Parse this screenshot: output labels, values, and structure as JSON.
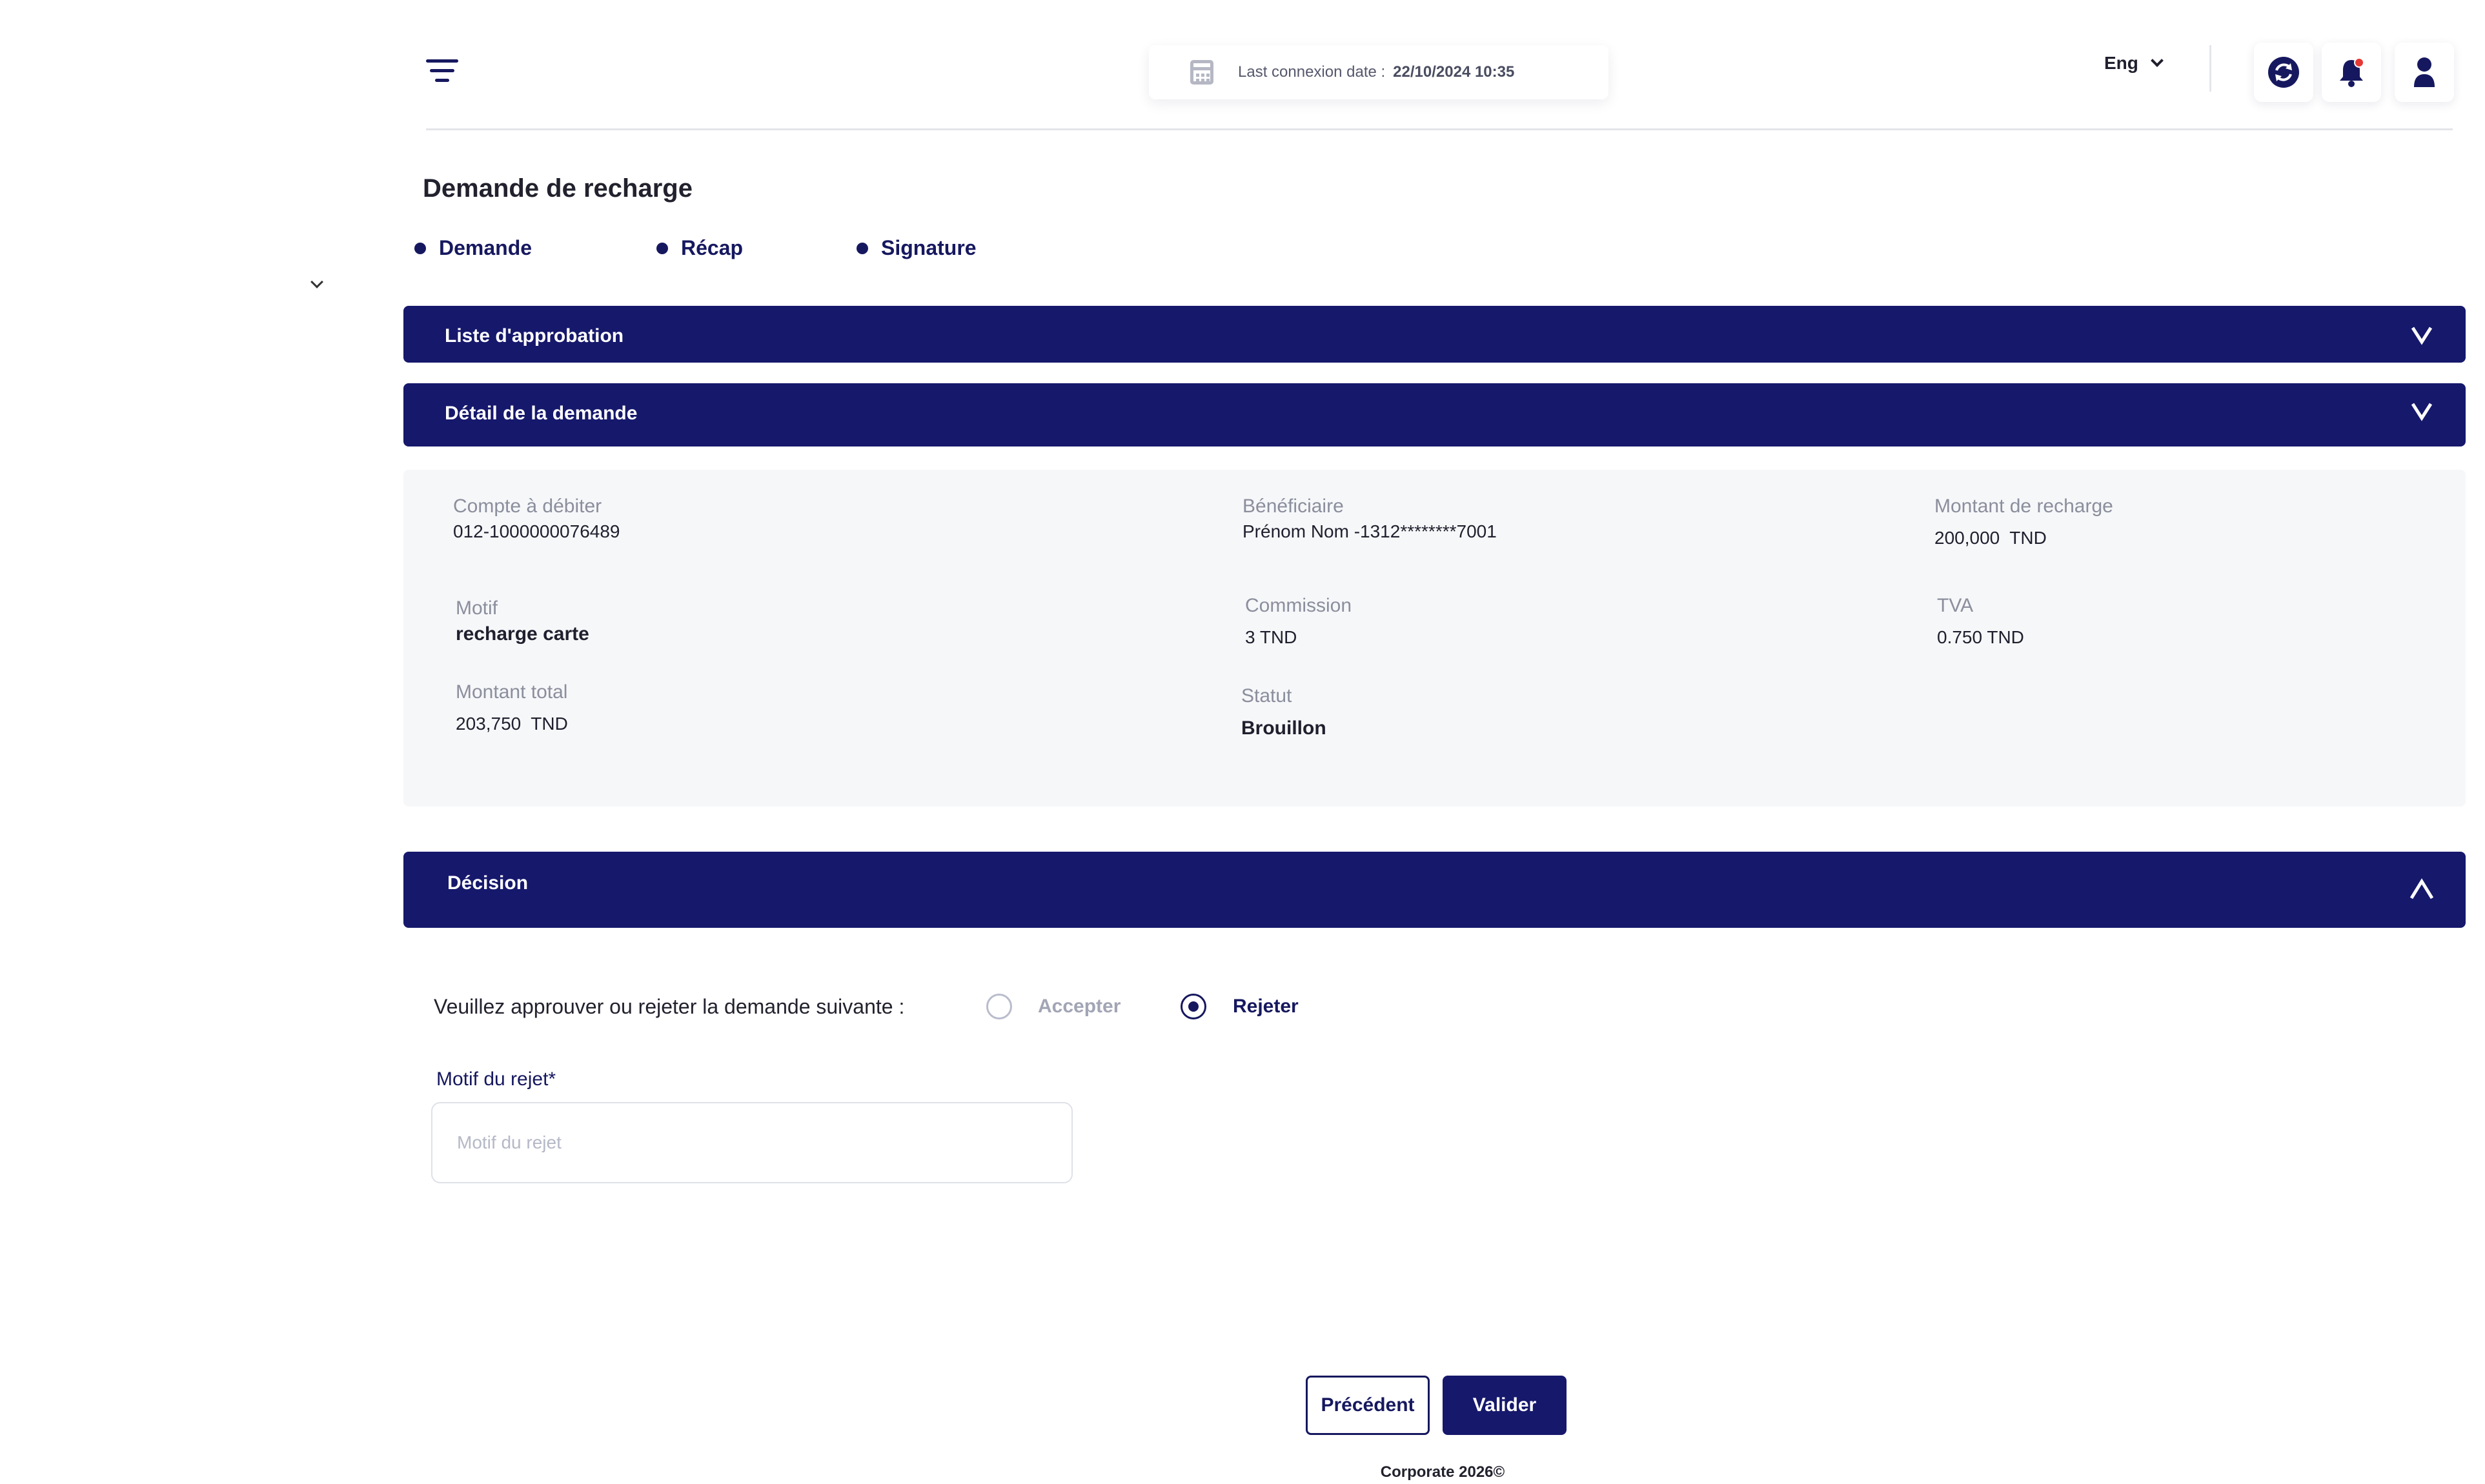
{
  "header": {
    "last_connexion_label": "Last connexion date :",
    "last_connexion_value": "22/10/2024 10:35",
    "language": "Eng",
    "icons": [
      "menu-icon",
      "calendar-icon",
      "sync-icon",
      "bell-icon",
      "user-icon"
    ],
    "notification_dot_color": "#e53935"
  },
  "page": {
    "title": "Demande de recharge",
    "steps": [
      "Demande",
      "Récap",
      "Signature"
    ]
  },
  "sections": {
    "approval_list": "Liste d'approbation",
    "request_detail": "Détail de la demande",
    "decision": "Décision"
  },
  "detail": {
    "compte_label": "Compte à débiter",
    "compte_value": "012-1000000076489",
    "beneficiaire_label": "Bénéficiaire",
    "beneficiaire_value": "Prénom Nom -1312********7001",
    "montant_label": "Montant de recharge",
    "montant_value": "200,000  TND",
    "motif_label": "Motif",
    "motif_value": "recharge carte",
    "commission_label": "Commission",
    "commission_value": "3 TND",
    "tva_label": "TVA",
    "tva_value": "0.750 TND",
    "total_label": "Montant total",
    "total_value": "203,750  TND",
    "statut_label": "Statut",
    "statut_value": "Brouillon"
  },
  "decision": {
    "question": "Veuillez approuver ou rejeter la demande suivante :",
    "accept_label": "Accepter",
    "reject_label": "Rejeter",
    "selected": "Rejeter",
    "reject_reason_label": "Motif du rejet*",
    "reject_reason_placeholder": "Motif du rejet",
    "reject_reason_value": ""
  },
  "actions": {
    "previous": "Précédent",
    "validate": "Valider"
  },
  "footer": {
    "copyright": "Corporate 2026©"
  },
  "colors": {
    "primary": "#16186c",
    "panel_bg": "#f6f7f9",
    "muted_label": "#8b8e9c"
  }
}
